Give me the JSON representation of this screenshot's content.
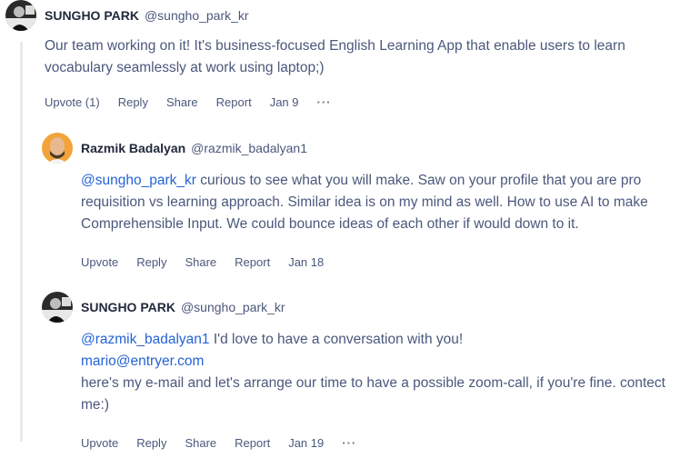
{
  "comments": [
    {
      "author": "SUNGHO PARK",
      "handle": "@sungho_park_kr",
      "text": "Our team working on it! It's business-focused English Learning App that enable users to learn vocabulary seamlessly at work using laptop;)",
      "actions": {
        "upvote": "Upvote (1)",
        "reply": "Reply",
        "share": "Share",
        "report": "Report",
        "date": "Jan 9",
        "more": "···"
      }
    },
    {
      "author": "Razmik Badalyan",
      "handle": "@razmik_badalyan1",
      "mention": "@sungho_park_kr",
      "text": " curious to see what you will make. Saw on your profile that you are pro requisition vs learning approach. Similar idea is on my mind as well. How to use AI to make Comprehensible Input. We could bounce ideas of each other if would down to it.",
      "actions": {
        "upvote": "Upvote",
        "reply": "Reply",
        "share": "Share",
        "report": "Report",
        "date": "Jan 18"
      }
    },
    {
      "author": "SUNGHO PARK",
      "handle": "@sungho_park_kr",
      "mention": "@razmik_badalyan1",
      "text_line1": " I'd love to have a conversation with you!",
      "email": "mario@entryer.com",
      "text_rest": "here's my e-mail and let's arrange our time to have a possible zoom-call, if you're fine. contect me:)",
      "actions": {
        "upvote": "Upvote",
        "reply": "Reply",
        "share": "Share",
        "report": "Report",
        "date": "Jan 19",
        "more": "···"
      }
    }
  ]
}
